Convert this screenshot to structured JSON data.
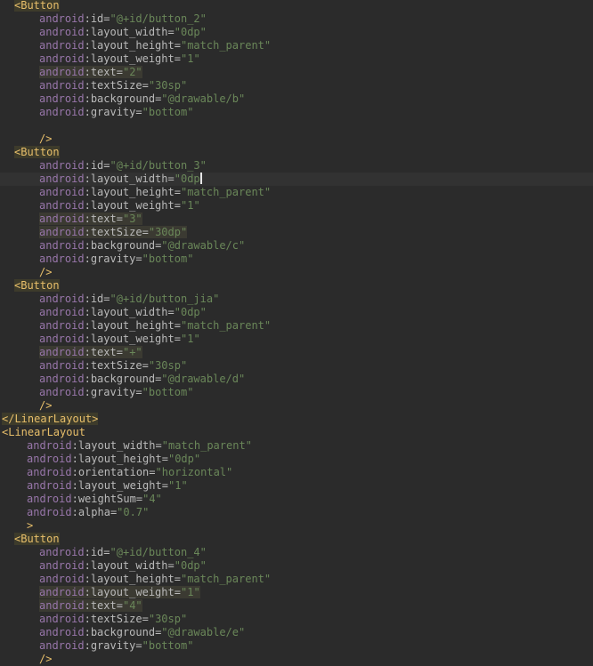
{
  "editor": {
    "file_language": "xml",
    "colors": {
      "background": "#2b2b2b",
      "current_line": "#323232",
      "tag": "#e8bf6a",
      "namespace": "#9876aa",
      "attribute": "#bababa",
      "string": "#6a8759",
      "highlight": "#3b3a32"
    },
    "lines": [
      {
        "indent": 1,
        "kind": "open",
        "tag": "Button",
        "hl_tag": true
      },
      {
        "indent": 3,
        "kind": "attr",
        "ns": "android",
        "name": "id",
        "value": "@+id/button_2"
      },
      {
        "indent": 3,
        "kind": "attr",
        "ns": "android",
        "name": "layout_width",
        "value": "0dp"
      },
      {
        "indent": 3,
        "kind": "attr",
        "ns": "android",
        "name": "layout_height",
        "value": "match_parent"
      },
      {
        "indent": 3,
        "kind": "attr",
        "ns": "android",
        "name": "layout_weight",
        "value": "1"
      },
      {
        "indent": 3,
        "kind": "attr",
        "ns": "android",
        "name": "text",
        "value": "2",
        "hl": true
      },
      {
        "indent": 3,
        "kind": "attr",
        "ns": "android",
        "name": "textSize",
        "value": "30sp"
      },
      {
        "indent": 3,
        "kind": "attr",
        "ns": "android",
        "name": "background",
        "value": "@drawable/b"
      },
      {
        "indent": 3,
        "kind": "attr",
        "ns": "android",
        "name": "gravity",
        "value": "bottom"
      },
      {
        "indent": 0,
        "kind": "blank"
      },
      {
        "indent": 3,
        "kind": "selfclose",
        "text": "/>"
      },
      {
        "indent": 1,
        "kind": "open",
        "tag": "Button",
        "hl_tag": true
      },
      {
        "indent": 3,
        "kind": "attr",
        "ns": "android",
        "name": "id",
        "value": "@+id/button_3"
      },
      {
        "indent": 3,
        "kind": "attr",
        "ns": "android",
        "name": "layout_width",
        "value": "0dp",
        "caret": true,
        "current": true
      },
      {
        "indent": 3,
        "kind": "attr",
        "ns": "android",
        "name": "layout_height",
        "value": "match_parent"
      },
      {
        "indent": 3,
        "kind": "attr",
        "ns": "android",
        "name": "layout_weight",
        "value": "1"
      },
      {
        "indent": 3,
        "kind": "attr",
        "ns": "android",
        "name": "text",
        "value": "3",
        "hl": true
      },
      {
        "indent": 3,
        "kind": "attr",
        "ns": "android",
        "name": "textSize",
        "value": "30dp",
        "hl": true
      },
      {
        "indent": 3,
        "kind": "attr",
        "ns": "android",
        "name": "background",
        "value": "@drawable/c"
      },
      {
        "indent": 3,
        "kind": "attr",
        "ns": "android",
        "name": "gravity",
        "value": "bottom"
      },
      {
        "indent": 3,
        "kind": "selfclose",
        "text": "/>"
      },
      {
        "indent": 1,
        "kind": "open",
        "tag": "Button",
        "hl_tag": true
      },
      {
        "indent": 3,
        "kind": "attr",
        "ns": "android",
        "name": "id",
        "value": "@+id/button_jia"
      },
      {
        "indent": 3,
        "kind": "attr",
        "ns": "android",
        "name": "layout_width",
        "value": "0dp"
      },
      {
        "indent": 3,
        "kind": "attr",
        "ns": "android",
        "name": "layout_height",
        "value": "match_parent"
      },
      {
        "indent": 3,
        "kind": "attr",
        "ns": "android",
        "name": "layout_weight",
        "value": "1"
      },
      {
        "indent": 3,
        "kind": "attr",
        "ns": "android",
        "name": "text",
        "value": "+",
        "hl": true
      },
      {
        "indent": 3,
        "kind": "attr",
        "ns": "android",
        "name": "textSize",
        "value": "30sp"
      },
      {
        "indent": 3,
        "kind": "attr",
        "ns": "android",
        "name": "background",
        "value": "@drawable/d"
      },
      {
        "indent": 3,
        "kind": "attr",
        "ns": "android",
        "name": "gravity",
        "value": "bottom"
      },
      {
        "indent": 3,
        "kind": "selfclose",
        "text": "/>"
      },
      {
        "indent": 0,
        "kind": "close",
        "tag": "LinearLayout",
        "hl_tag": true
      },
      {
        "indent": 0,
        "kind": "open",
        "tag": "LinearLayout"
      },
      {
        "indent": 2,
        "kind": "attr",
        "ns": "android",
        "name": "layout_width",
        "value": "match_parent"
      },
      {
        "indent": 2,
        "kind": "attr",
        "ns": "android",
        "name": "layout_height",
        "value": "0dp"
      },
      {
        "indent": 2,
        "kind": "attr",
        "ns": "android",
        "name": "orientation",
        "value": "horizontal"
      },
      {
        "indent": 2,
        "kind": "attr",
        "ns": "android",
        "name": "layout_weight",
        "value": "1"
      },
      {
        "indent": 2,
        "kind": "attr",
        "ns": "android",
        "name": "weightSum",
        "value": "4"
      },
      {
        "indent": 2,
        "kind": "attr",
        "ns": "android",
        "name": "alpha",
        "value": "0.7"
      },
      {
        "indent": 2,
        "kind": "endopen",
        "text": ">"
      },
      {
        "indent": 1,
        "kind": "open",
        "tag": "Button",
        "hl_tag": true
      },
      {
        "indent": 3,
        "kind": "attr",
        "ns": "android",
        "name": "id",
        "value": "@+id/button_4"
      },
      {
        "indent": 3,
        "kind": "attr",
        "ns": "android",
        "name": "layout_width",
        "value": "0dp"
      },
      {
        "indent": 3,
        "kind": "attr",
        "ns": "android",
        "name": "layout_height",
        "value": "match_parent"
      },
      {
        "indent": 3,
        "kind": "attr",
        "ns": "android",
        "name": "layout_weight",
        "value": "1",
        "hl": true
      },
      {
        "indent": 3,
        "kind": "attr",
        "ns": "android",
        "name": "text",
        "value": "4",
        "hl": true
      },
      {
        "indent": 3,
        "kind": "attr",
        "ns": "android",
        "name": "textSize",
        "value": "30sp"
      },
      {
        "indent": 3,
        "kind": "attr",
        "ns": "android",
        "name": "background",
        "value": "@drawable/e"
      },
      {
        "indent": 3,
        "kind": "attr",
        "ns": "android",
        "name": "gravity",
        "value": "bottom"
      },
      {
        "indent": 3,
        "kind": "selfclose",
        "text": "/>"
      }
    ]
  }
}
